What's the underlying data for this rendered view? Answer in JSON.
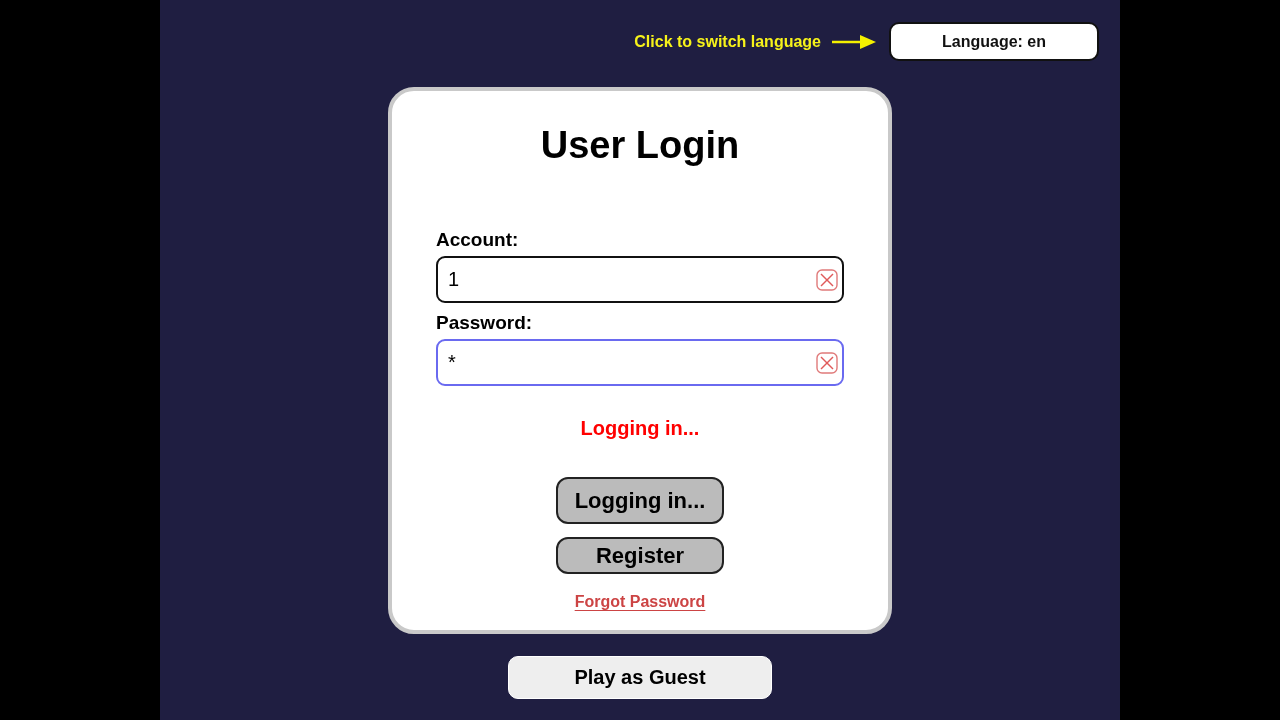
{
  "language_hint": {
    "text": "Click to switch language"
  },
  "language_button": {
    "label": "Language: en"
  },
  "login_card": {
    "title": "User Login",
    "fields": [
      {
        "label": "Account:",
        "value": "1",
        "focused": false
      },
      {
        "label": "Password:",
        "value": "*",
        "focused": true
      }
    ],
    "status": "Logging in...",
    "buttons": [
      {
        "label": "Logging in...",
        "kind": "primary"
      },
      {
        "label": "Register",
        "kind": "secondary"
      }
    ],
    "forgot_link": "Forgot Password"
  },
  "guest_button": {
    "label": "Play as Guest"
  }
}
